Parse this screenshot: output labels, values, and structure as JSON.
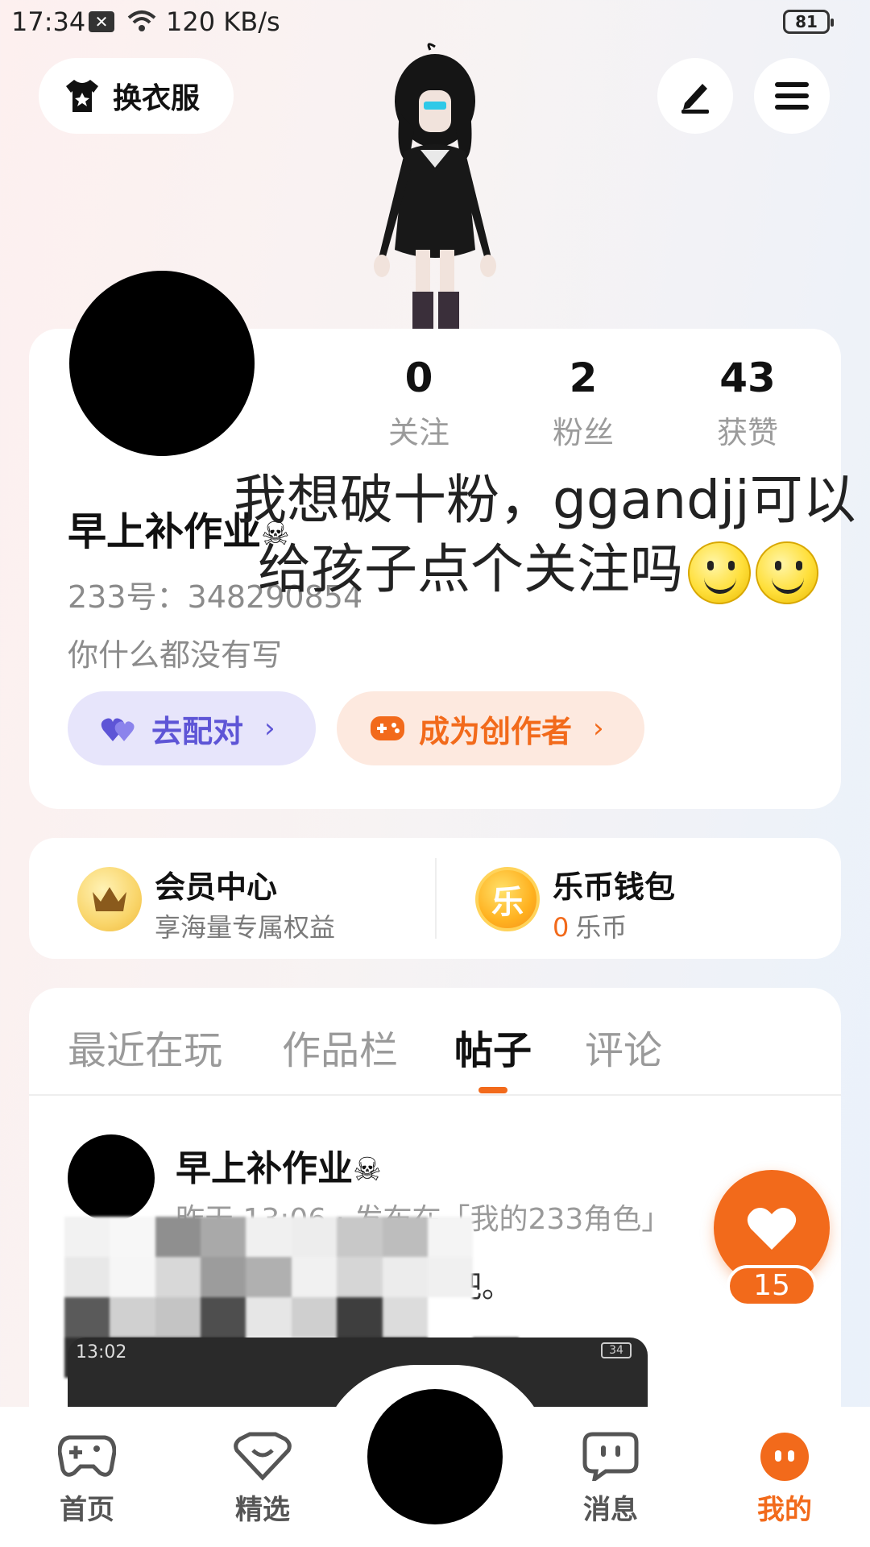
{
  "status_bar": {
    "time": "17:34",
    "network_speed": "120 KB/s",
    "battery": "81"
  },
  "top": {
    "dress_label": "换衣服"
  },
  "profile": {
    "stats": [
      {
        "value": "0",
        "label": "关注"
      },
      {
        "value": "2",
        "label": "粉丝"
      },
      {
        "value": "43",
        "label": "获赞"
      }
    ],
    "username": "早上补作业",
    "user_id": "233号：348290854",
    "bio": "你什么都没有写",
    "overlay_line1": "我想破十粉，ggandjj可以",
    "overlay_line2": "给孩子点个关注吗",
    "match_button": "去配对",
    "creator_button": "成为创作者"
  },
  "vip": {
    "title": "会员中心",
    "subtitle": "享海量专属权益"
  },
  "wallet": {
    "title": "乐币钱包",
    "icon_char": "乐",
    "count": "0",
    "unit": "乐币"
  },
  "tabs": [
    {
      "label": "最近在玩"
    },
    {
      "label": "作品栏"
    },
    {
      "label": "帖子"
    },
    {
      "label": "评论"
    }
  ],
  "post": {
    "author": "早上补作业",
    "meta": "昨天 13:06 · 发布在「我的233角色」",
    "text_start": "晴",
    "text_end": "吧。",
    "thumb_time": "13:02",
    "thumb_battery": "34",
    "like_count": "15"
  },
  "bottom_nav": [
    {
      "label": "首页"
    },
    {
      "label": "精选"
    },
    {
      "label": "消息"
    },
    {
      "label": "我的"
    }
  ],
  "colors": {
    "accent": "#f26a1b",
    "match_purple": "#5e55d6"
  }
}
